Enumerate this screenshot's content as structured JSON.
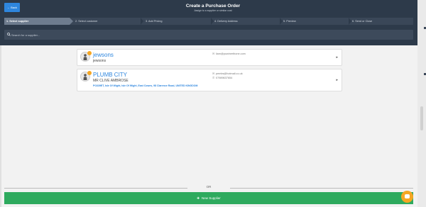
{
  "header": {
    "back_label": "← Back",
    "title": "Create a Purchase Order",
    "subtitle": "Assign to a supplier or similar cost"
  },
  "steps": [
    {
      "label": "1. Select supplier",
      "active": true
    },
    {
      "label": "2. Select customer",
      "active": false
    },
    {
      "label": "3. Add Pricing",
      "active": false
    },
    {
      "label": "4. Delivery Address",
      "active": false
    },
    {
      "label": "5. Preview",
      "active": false
    },
    {
      "label": "6. Send or Close",
      "active": false
    }
  ],
  "search": {
    "placeholder": "Search for a supplier...",
    "value": "",
    "icon": "search-icon"
  },
  "suppliers": [
    {
      "name": "jewsons",
      "subname": "jewsons",
      "address": "",
      "email": "liam@powinerthone.com",
      "phone": ""
    },
    {
      "name": "PLUMB CITY",
      "subname": "MR CLIVE AMBROSE",
      "address": "PO339ET, Isle Of Wight, Isle Of Wight, East Cowes, 98 Clarence Road, UNITED KINGDOM",
      "email": "pembs@hotmail.co.uk",
      "phone": "07989637654"
    }
  ],
  "divider": {
    "or_label": "OR"
  },
  "actions": {
    "new_supplier_label": "New Supplier"
  },
  "colors": {
    "header_bg": "#2d3a4a",
    "accent_blue": "#2e86de",
    "accent_green": "#2eaa5e",
    "chat_orange": "#f5a623"
  }
}
